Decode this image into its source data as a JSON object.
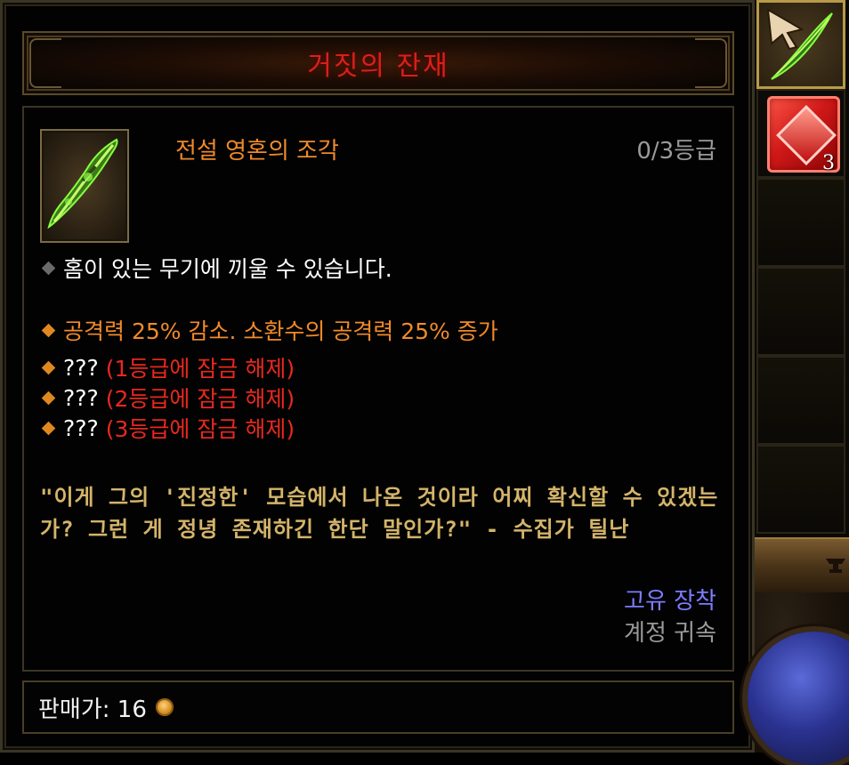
{
  "tooltip": {
    "title": "거짓의 잔재",
    "item_name": "전설 영혼의 조각",
    "rank": "0/3등급",
    "properties": [
      {
        "text": "홈이 있는 무기에 끼울 수 있습니다.",
        "style": "white"
      },
      {
        "text": "공격력 25% 감소. 소환수의 공격력 25% 증가",
        "style": "orange"
      },
      {
        "prefix": "???",
        "text": "(1등급에 잠금 해제)",
        "style": "locked"
      },
      {
        "prefix": "???",
        "text": "(2등급에 잠금 해제)",
        "style": "locked"
      },
      {
        "prefix": "???",
        "text": "(3등급에 잠금 해제)",
        "style": "locked"
      }
    ],
    "flavor": "\"이게 그의 '진정한' 모습에서 나온 것이라 어찌 확신할 수 있겠는가? 그런 게 정녕 존재하긴 한단 말인가?\" - 수집가 틸난",
    "unique_equip": "고유 장착",
    "account_bound": "계정 귀속",
    "price_label": "판매가: 16"
  },
  "side_panel": {
    "gem_count": "3"
  },
  "colors": {
    "title_red": "#d8201a",
    "legendary_orange": "#f08a2a",
    "locked_red": "#e8281e",
    "flavor_gold": "#d4b46a",
    "unique_blue": "#7c7cff",
    "bound_grey": "#9a9a9a"
  },
  "icons": [
    "item-shard-icon",
    "cursor-icon",
    "red-gem-icon",
    "gold-coin-icon",
    "anvil-icon"
  ]
}
